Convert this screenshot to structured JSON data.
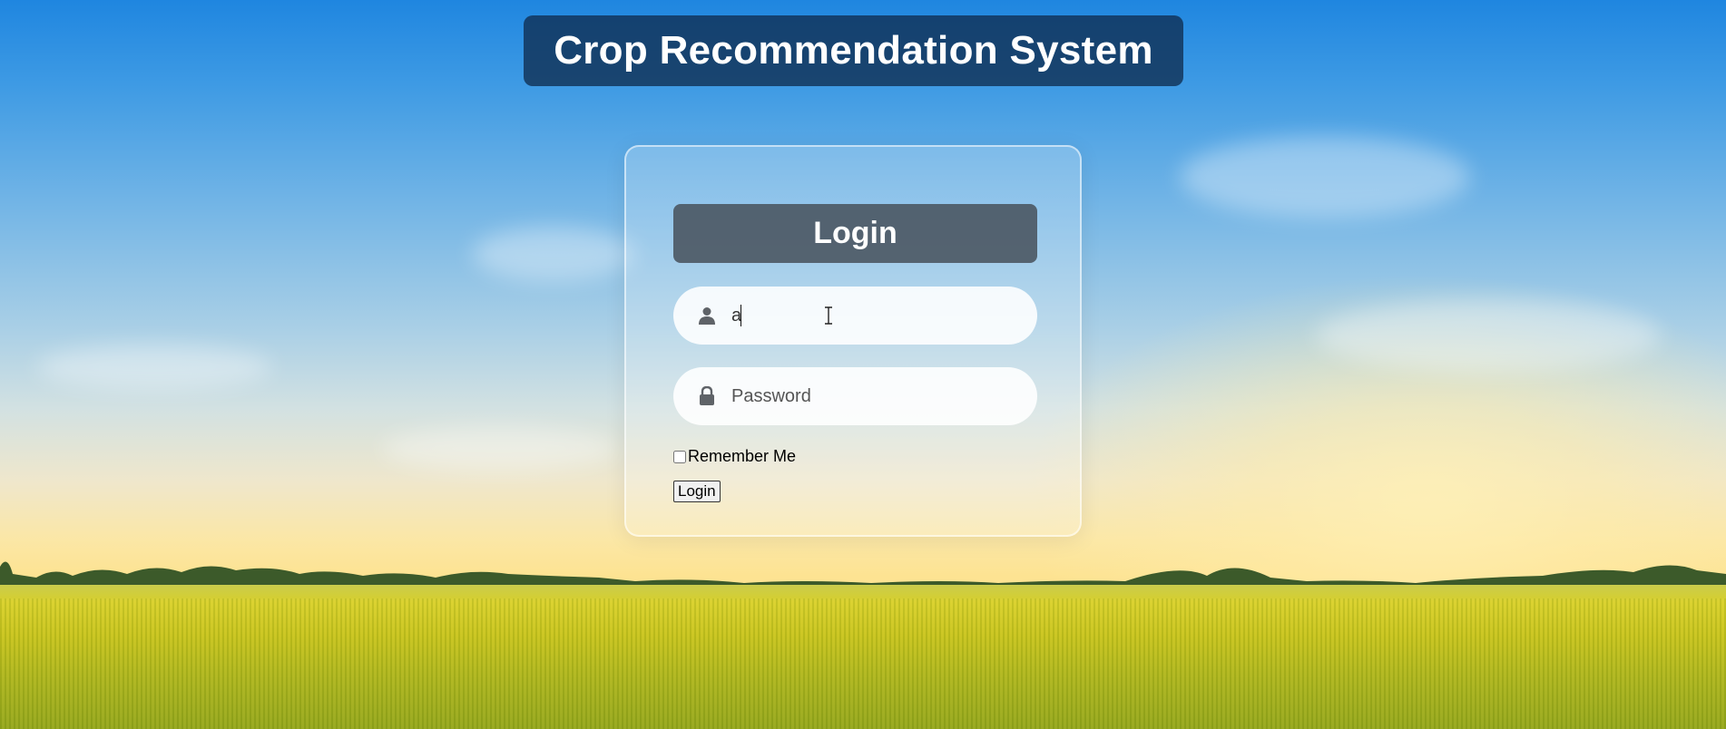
{
  "app": {
    "title": "Crop Recommendation System"
  },
  "login": {
    "header": "Login",
    "username": {
      "value": "a",
      "icon": "user-icon"
    },
    "password": {
      "value": "",
      "placeholder": "Password",
      "icon": "lock-icon"
    },
    "remember_label": "Remember Me",
    "remember_checked": false,
    "submit_label": "Login"
  },
  "colors": {
    "title_bg": "#0f2d50",
    "header_bg": "#46505a",
    "icon": "#5f6368"
  }
}
